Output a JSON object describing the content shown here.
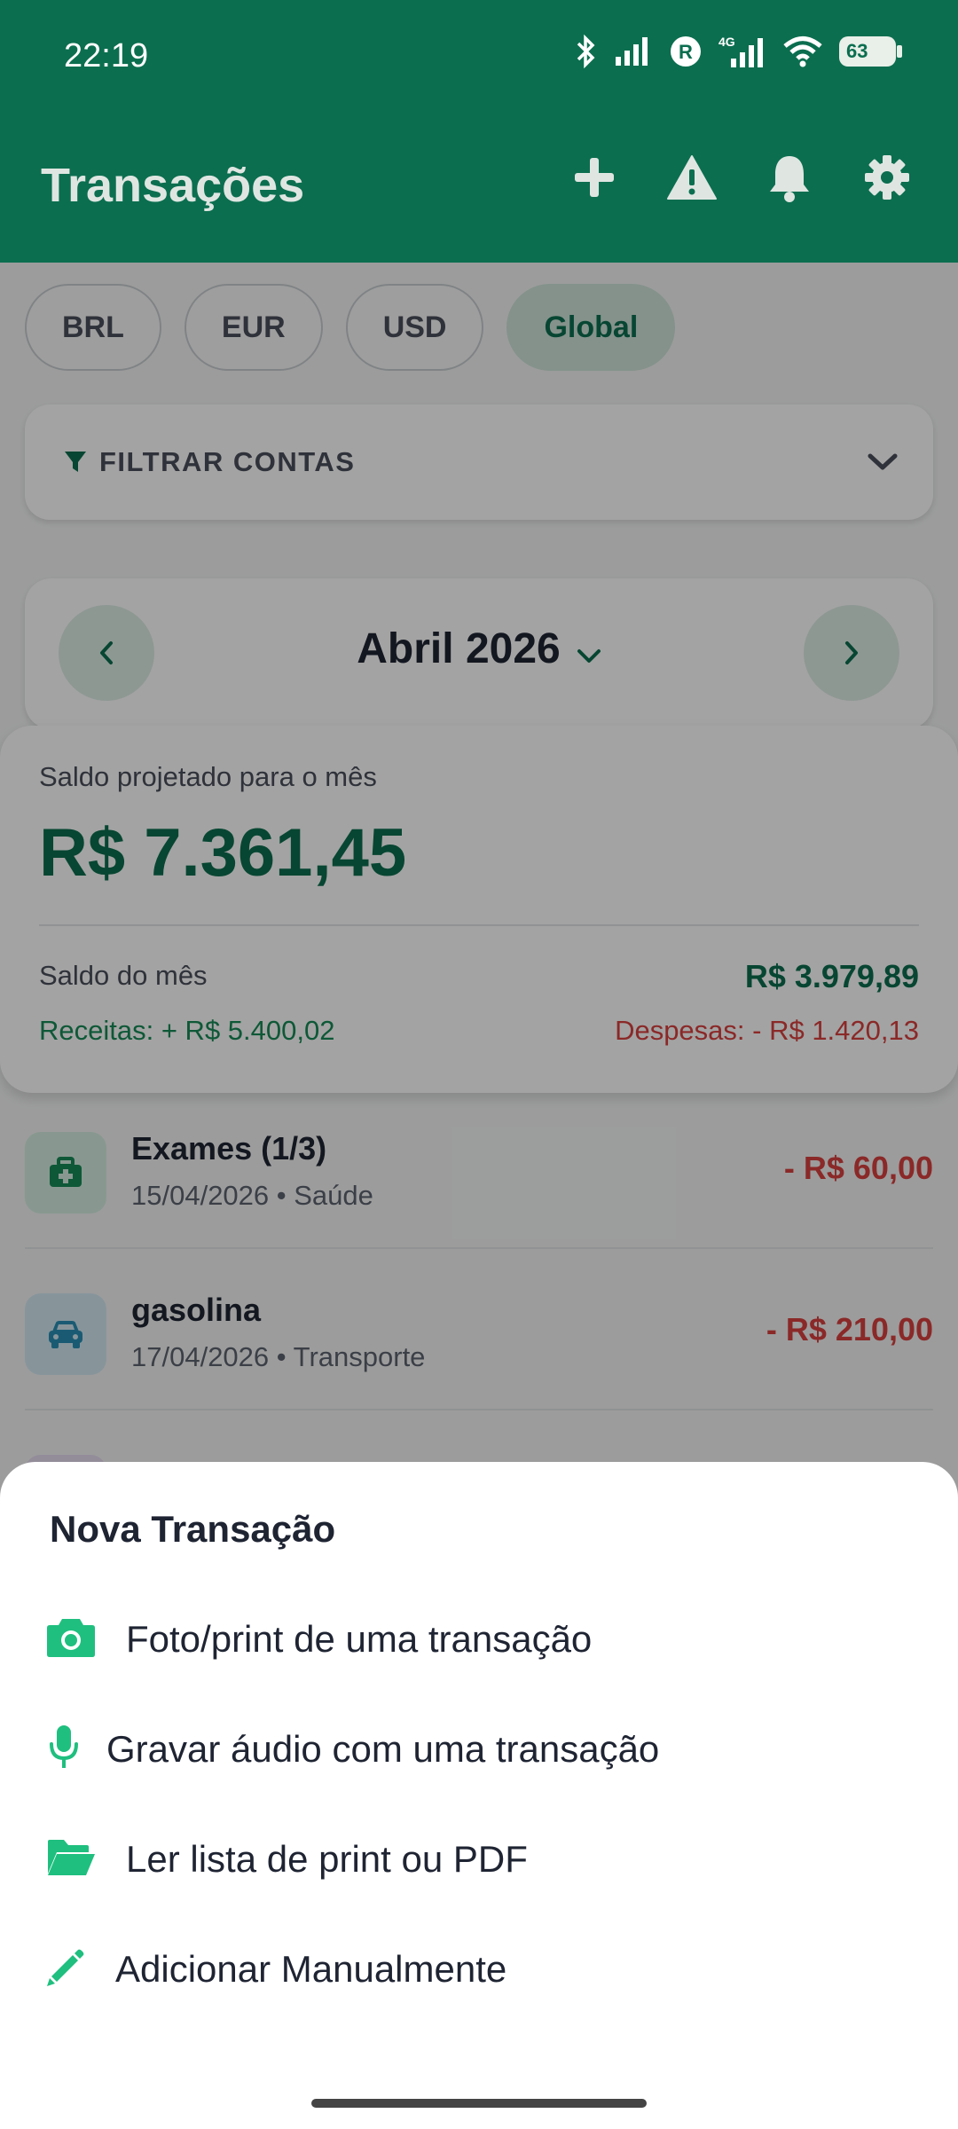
{
  "status_bar": {
    "time": "22:19",
    "battery": "63"
  },
  "app_bar": {
    "title": "Transações"
  },
  "currency_chips": [
    {
      "label": "BRL",
      "active": false
    },
    {
      "label": "EUR",
      "active": false
    },
    {
      "label": "USD",
      "active": false
    },
    {
      "label": "Global",
      "active": true
    }
  ],
  "filter": {
    "label": "FILTRAR CONTAS"
  },
  "month_nav": {
    "label": "Abril 2026"
  },
  "summary": {
    "projected_caption": "Saldo projetado para o mês",
    "projected_value": "R$ 7.361,45",
    "month_balance_label": "Saldo do mês",
    "month_balance_value": "R$ 3.979,89",
    "income": "Receitas: + R$ 5.400,02",
    "expenses": "Despesas: - R$ 1.420,13"
  },
  "transactions": [
    {
      "title": "Exames (1/3)",
      "subtitle": "15/04/2026 • Saúde",
      "amount": "- R$ 60,00",
      "icon": "medical-kit-icon"
    },
    {
      "title": "gasolina",
      "subtitle": "17/04/2026 • Transporte",
      "amount": "- R$ 210,00",
      "icon": "car-icon"
    }
  ],
  "sheet": {
    "title": "Nova Transação",
    "options": [
      {
        "label": "Foto/print de uma transação",
        "icon": "camera-icon"
      },
      {
        "label": "Gravar áudio com uma transação",
        "icon": "microphone-icon"
      },
      {
        "label": "Ler lista de print ou PDF",
        "icon": "folder-open-icon"
      },
      {
        "label": "Adicionar Manualmente",
        "icon": "pencil-icon"
      }
    ]
  },
  "colors": {
    "primary": "#0b6e4f",
    "accent": "#1fbf7f",
    "expense": "#d8413f",
    "income": "#178a57"
  }
}
